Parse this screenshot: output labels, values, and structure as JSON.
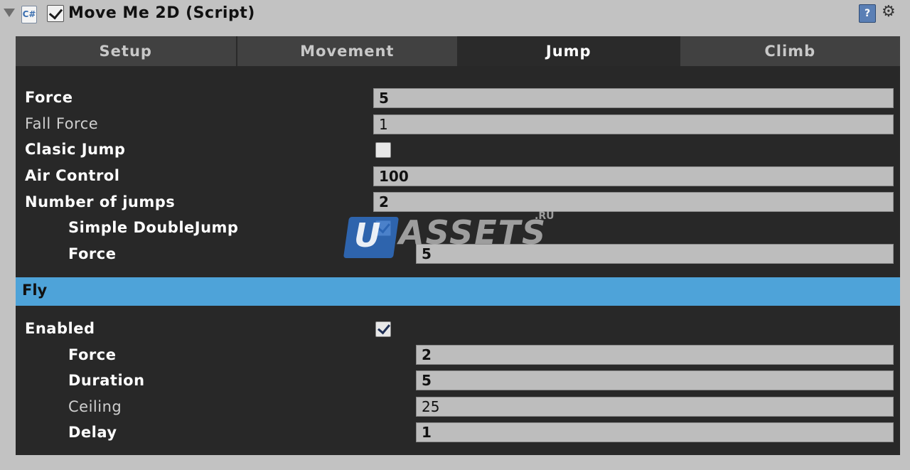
{
  "header": {
    "title": "Move Me 2D (Script)",
    "enabled": true,
    "script_icon": "csharp-script-icon",
    "script_icon_glyph": "C#",
    "help_icon_glyph": "?",
    "gear_icon_glyph": "⚙"
  },
  "tabs": [
    {
      "label": "Setup",
      "active": false
    },
    {
      "label": "Movement",
      "active": false
    },
    {
      "label": "Jump",
      "active": true
    },
    {
      "label": "Climb",
      "active": false
    }
  ],
  "jump": {
    "force": {
      "label": "Force",
      "value": "5"
    },
    "fall_force": {
      "label": "Fall Force",
      "value": "1"
    },
    "clasic_jump": {
      "label": "Clasic Jump",
      "checked": false
    },
    "air_control": {
      "label": "Air Control",
      "value": "100"
    },
    "number_of_jumps": {
      "label": "Number of jumps",
      "value": "2"
    },
    "simple_double_jump": {
      "label": "Simple DoubleJump",
      "checked": true
    },
    "double_jump_force": {
      "label": "Force",
      "value": "5"
    }
  },
  "fly": {
    "section_title": "Fly",
    "enabled": {
      "label": "Enabled",
      "checked": true
    },
    "force": {
      "label": "Force",
      "value": "2"
    },
    "duration": {
      "label": "Duration",
      "value": "5"
    },
    "ceiling": {
      "label": "Ceiling",
      "value": "25"
    },
    "delay": {
      "label": "Delay",
      "value": "1"
    }
  },
  "watermark": {
    "logo_letter": "U",
    "text": "ASSETS",
    "suffix": ".RU"
  },
  "colors": {
    "fly_header": "#4ea3d9",
    "panel_bg": "#282828",
    "field_bg": "#bdbdbd"
  }
}
